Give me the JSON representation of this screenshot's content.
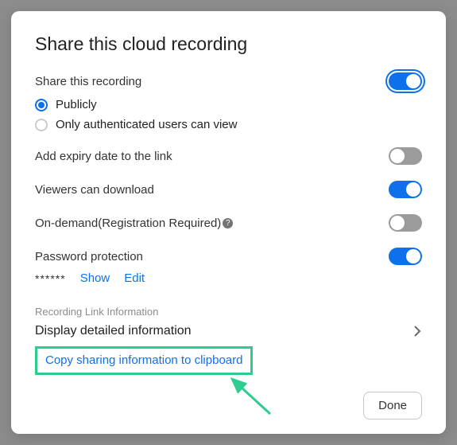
{
  "colors": {
    "accent": "#0e71eb",
    "highlight": "#2ecc8f"
  },
  "title": "Share this cloud recording",
  "share_label": "Share this recording",
  "options": {
    "publicly": "Publicly",
    "authenticated": "Only authenticated users can view"
  },
  "settings": {
    "expiry": "Add expiry date to the link",
    "download": "Viewers can download",
    "ondemand": "On-demand(Registration Required)",
    "password": "Password protection"
  },
  "password": {
    "masked": "******",
    "show": "Show",
    "edit": "Edit"
  },
  "link_section": {
    "heading": "Recording Link Information",
    "detail": "Display detailed information",
    "copy": "Copy sharing information to clipboard"
  },
  "footer": {
    "done": "Done"
  },
  "help_glyph": "?"
}
